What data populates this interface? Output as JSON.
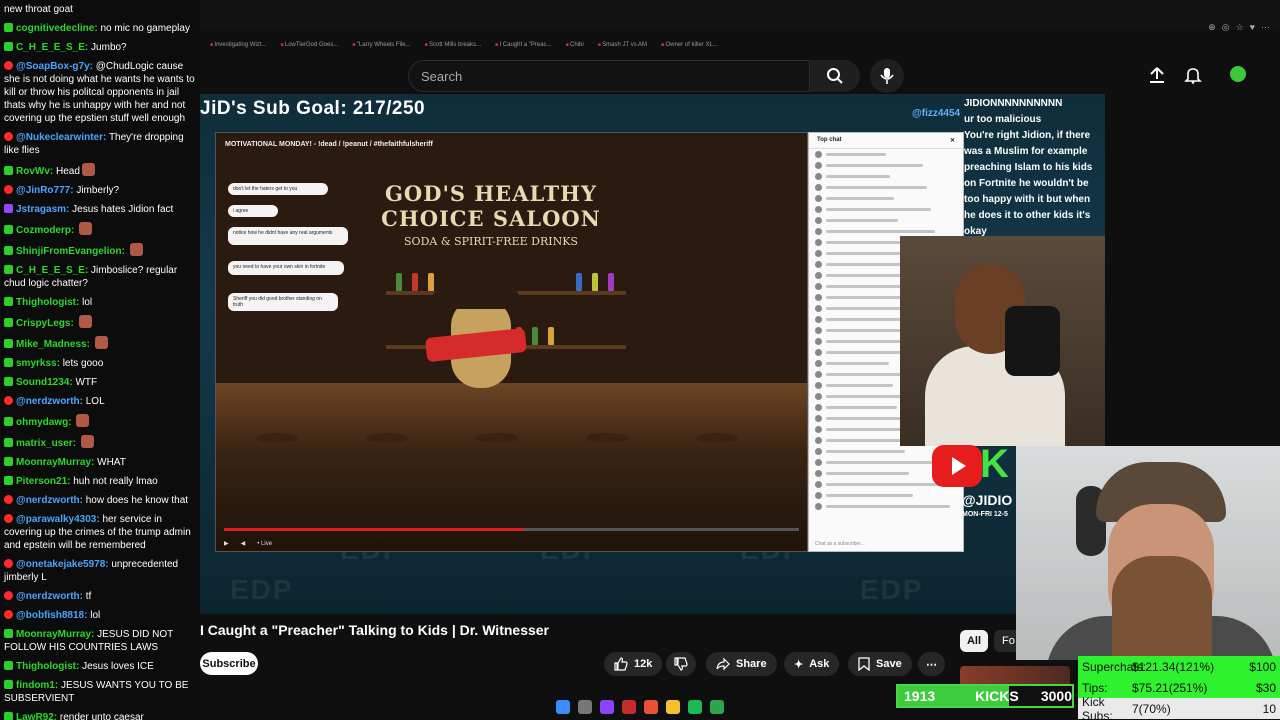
{
  "browser": {
    "bookmarks": [
      "Investigating Wizt...",
      "LowTierGod Goes...",
      "\"Larry Wheels File...",
      "Scott Mills breaks...",
      "I Caught a \"Preac...",
      "Chibi",
      "Smash JT vs AM",
      "Owner of killer XL..."
    ]
  },
  "youtube": {
    "search_placeholder": "Search",
    "video_title": "I Caught a \"Preacher\" Talking to Kids | Dr. Witnesser",
    "subscribe_label": "Subscribe",
    "like_count": "12k",
    "share_label": "Share",
    "ask_label": "Ask",
    "save_label": "Save",
    "chip_all": "All",
    "chip_fo": "Fo"
  },
  "stream": {
    "sub_goal": "JiD's Sub Goal: 217/250",
    "fizz_handle": "@fizz4454",
    "jidion_handle": "@JIDIO",
    "jidion_schedule": "MON-FRI 12-5",
    "overlay_chat": [
      "JIDIONNNNNNNNNN",
      "ur too malicious",
      "You're right Jidion, if there was a Muslim for example preaching Islam to his kids on Fortnite he wouldn't be too happy with it but when he does it to other kids it's okay"
    ]
  },
  "inner_video": {
    "title": "MOTIVATIONAL MONDAY! - !dead / !peanut / #thefaithfulsheriff",
    "sign_big": "GOD'S HEALTHY CHOICE SALOON",
    "sign_small": "SODA & SPIRIT-FREE DRINKS",
    "live_label": "• Live",
    "bubbles": [
      "don't let the haters get to you",
      "i agree",
      "notice how he didnt have any real arguments",
      "you need to have your own skin in fortnite",
      "Sheriff you did good brother standing on truth"
    ],
    "chat_header": "Top chat",
    "chat_footer": "Chat as a subscriber..."
  },
  "goal_bar": {
    "current": "1913",
    "label": "KICKS",
    "target": "3000",
    "progress": 0.638
  },
  "supers": [
    {
      "key": "Superchats:",
      "value": "$121.34(121%)",
      "target": "$100"
    },
    {
      "key": "Tips:",
      "value": "$75.21(251%)",
      "target": "$30"
    },
    {
      "key": "Kick Subs:",
      "value": "7(70%)",
      "target": "10"
    }
  ],
  "chat": [
    {
      "platform": "none",
      "user": "",
      "text": "new throat goat"
    },
    {
      "platform": "kick",
      "user": "cognitivedecline:",
      "text": "no mic no gameplay"
    },
    {
      "platform": "kick",
      "user": "C_H_E_E_S_E:",
      "text": "Jumbo?"
    },
    {
      "platform": "yt",
      "user": "@SoapBox-g7y:",
      "text": "@ChudLogic cause she is not doing what he wants he wants to kill or throw his politcal opponents in jail thats why he is unhappy with her and not covering up the epstien stuff well enough"
    },
    {
      "platform": "yt",
      "user": "@Nukeclearwinter:",
      "text": "They're dropping like flies"
    },
    {
      "platform": "kick",
      "user": "RovWv:",
      "text": "Head",
      "emote": true
    },
    {
      "platform": "yt",
      "user": "@JinRo777:",
      "text": "Jimberly?"
    },
    {
      "platform": "tw",
      "user": "Jstragasm:",
      "text": "Jesus hates Jidion fact"
    },
    {
      "platform": "kick",
      "user": "Cozmoderp:",
      "text": "",
      "emote": true
    },
    {
      "platform": "kick",
      "user": "ShinjiFromEvangelion:",
      "text": "",
      "emote": true
    },
    {
      "platform": "kick",
      "user": "C_H_E_E_S_E:",
      "text": "Jimboslice? regular chud logic chatter?"
    },
    {
      "platform": "kick",
      "user": "Thighologist:",
      "text": "lol"
    },
    {
      "platform": "kick",
      "user": "CrispyLegs:",
      "text": "",
      "emote": true
    },
    {
      "platform": "kick",
      "user": "Mike_Madness:",
      "text": "",
      "emote": true
    },
    {
      "platform": "kick",
      "user": "smyrkss:",
      "text": "lets gooo"
    },
    {
      "platform": "kick",
      "user": "Sound1234:",
      "text": "WTF"
    },
    {
      "platform": "yt",
      "user": "@nerdzworth:",
      "text": "LOL"
    },
    {
      "platform": "kick",
      "user": "ohmydawg:",
      "text": "",
      "emote": true
    },
    {
      "platform": "kick",
      "user": "matrix_user:",
      "text": "",
      "emote": true
    },
    {
      "platform": "kick",
      "user": "MoonrayMurray:",
      "text": "WHAT"
    },
    {
      "platform": "kick",
      "user": "Piterson21:",
      "text": "huh not really lmao"
    },
    {
      "platform": "yt",
      "user": "@nerdzworth:",
      "text": "how does he know that"
    },
    {
      "platform": "yt",
      "user": "@parawalky4303:",
      "text": "her service in covering up the crimes of the trump admin and epstein will be remembered"
    },
    {
      "platform": "yt",
      "user": "@onetakejake5978:",
      "text": "unprecedented jimberly L"
    },
    {
      "platform": "yt",
      "user": "@nerdzworth:",
      "text": "tf"
    },
    {
      "platform": "yt",
      "user": "@bobfish8818:",
      "text": "lol"
    },
    {
      "platform": "kick",
      "user": "MoonrayMurray:",
      "text": "JESUS DID NOT FOLLOW HIS COUNTRIES LAWS"
    },
    {
      "platform": "kick",
      "user": "Thighologist:",
      "text": "Jesus loves ICE"
    },
    {
      "platform": "kick",
      "user": "findom1:",
      "text": "JESUS WANTS YOU TO BE SUBSERVIENT"
    },
    {
      "platform": "kick",
      "user": "LawR92:",
      "text": "render unto caesar"
    }
  ],
  "colors": {
    "kick_green": "#2bd02b",
    "yt_red": "#ff2b2b",
    "accent_blue": "#4aa5ff"
  }
}
